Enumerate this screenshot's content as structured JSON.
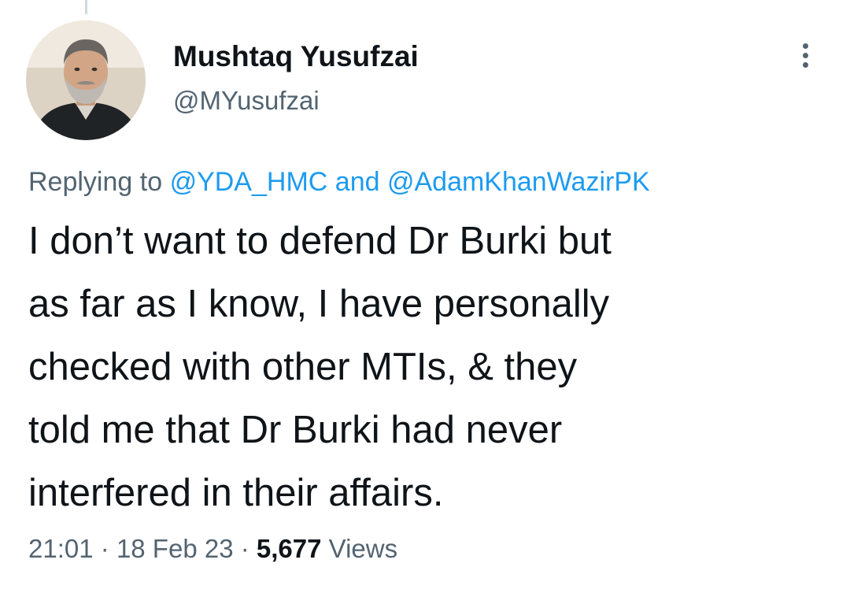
{
  "tweet": {
    "author": {
      "display_name": "Mushtaq Yusufzai",
      "handle": "@MYusufzai"
    },
    "replying_to": {
      "prefix": "Replying to",
      "mention_1": "@YDA_HMC",
      "conjunction": "and",
      "mention_2": "@AdamKhanWazirPK"
    },
    "text_lines": [
      "I don’t want to defend Dr Burki but",
      "as far as I know, I have personally",
      "checked with other MTIs, & they",
      "told me that Dr Burki had never",
      "interfered in their affairs."
    ],
    "meta": {
      "time": "21:01",
      "separator": "·",
      "date": "18 Feb 23",
      "views_count": "5,677",
      "views_label": "Views"
    }
  },
  "icons": {
    "more": "more-vertical-icon",
    "avatar": "profile-photo"
  },
  "colors": {
    "text_primary": "#0f1419",
    "text_secondary": "#536471",
    "link": "#1d9bf0"
  }
}
